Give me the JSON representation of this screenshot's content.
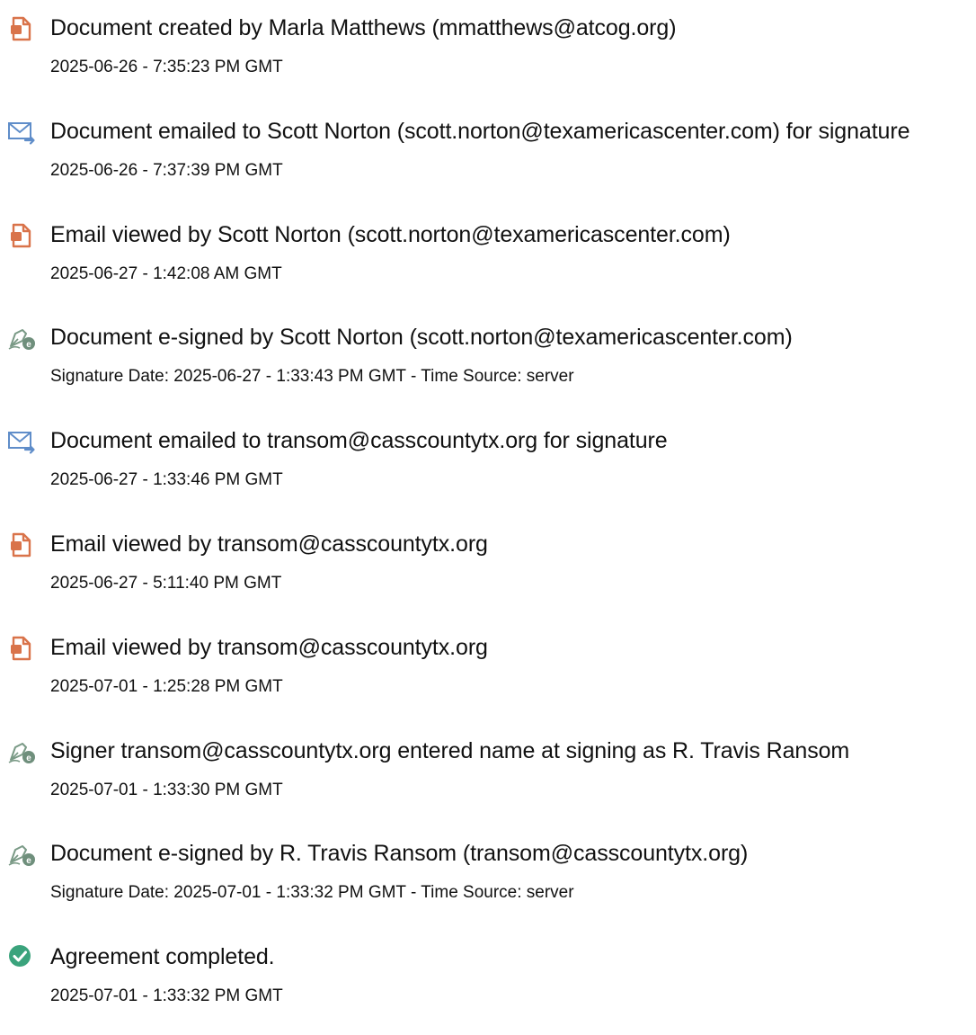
{
  "events": [
    {
      "icon": "document-created-icon",
      "title": "Document created by Marla Matthews (mmatthews@atcog.org)",
      "detail": "2025-06-26 - 7:35:23 PM GMT"
    },
    {
      "icon": "email-sent-icon",
      "title": "Document emailed to Scott Norton (scott.norton@texamericascenter.com) for signature",
      "detail": "2025-06-26 - 7:37:39 PM GMT"
    },
    {
      "icon": "document-viewed-icon",
      "title": "Email viewed by Scott Norton (scott.norton@texamericascenter.com)",
      "detail": "2025-06-27 - 1:42:08 AM GMT"
    },
    {
      "icon": "e-sign-pen-icon",
      "title": "Document e-signed by Scott Norton (scott.norton@texamericascenter.com)",
      "detail": "Signature Date: 2025-06-27 - 1:33:43 PM GMT - Time Source: server"
    },
    {
      "icon": "email-sent-icon",
      "title": "Document emailed to transom@casscountytx.org for signature",
      "detail": "2025-06-27 - 1:33:46 PM GMT"
    },
    {
      "icon": "document-viewed-icon",
      "title": "Email viewed by transom@casscountytx.org",
      "detail": "2025-06-27 - 5:11:40 PM GMT"
    },
    {
      "icon": "document-viewed-icon",
      "title": "Email viewed by transom@casscountytx.org",
      "detail": "2025-07-01 - 1:25:28 PM GMT"
    },
    {
      "icon": "e-sign-pen-icon",
      "title": "Signer transom@casscountytx.org entered name at signing as R. Travis Ransom",
      "detail": "2025-07-01 - 1:33:30 PM GMT"
    },
    {
      "icon": "e-sign-pen-icon",
      "title": "Document e-signed by R. Travis Ransom (transom@casscountytx.org)",
      "detail": "Signature Date: 2025-07-01 - 1:33:32 PM GMT - Time Source: server"
    },
    {
      "icon": "completed-check-icon",
      "title": "Agreement completed.",
      "detail": "2025-07-01 - 1:33:32 PM GMT"
    }
  ],
  "colors": {
    "document_icon": "#d9734a",
    "email_icon": "#5f8dc9",
    "pen_icon": "#7a9a86",
    "check_icon": "#3aa37c",
    "text": "#111111"
  }
}
